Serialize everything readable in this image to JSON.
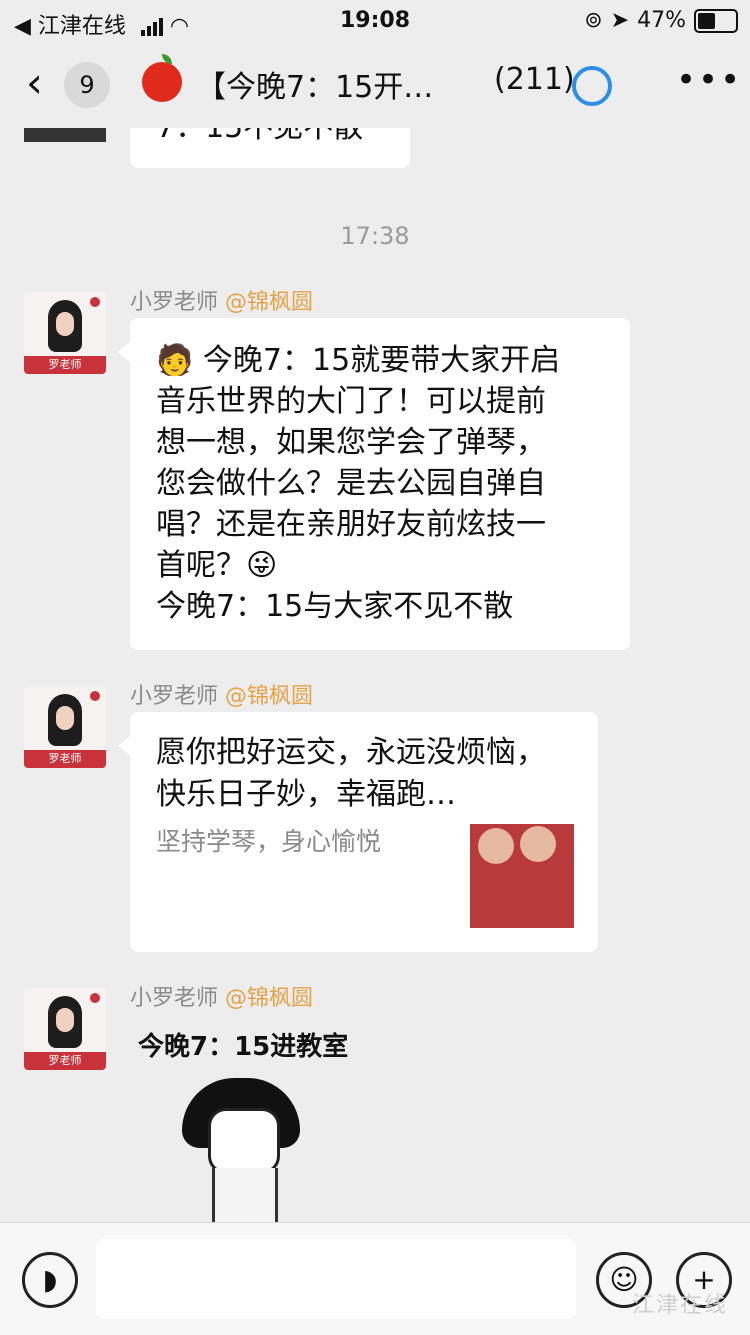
{
  "status_bar": {
    "back_app": "◀ 江津在线",
    "time": "19:08",
    "battery": "47%"
  },
  "nav": {
    "unread": "9",
    "title": "【今晚7：15开…",
    "member_count": "(211)"
  },
  "prev_bubble_tail": "7：15不见不散",
  "timestamp": "17:38",
  "messages": [
    {
      "sender": "小罗老师",
      "group_tag": "@锦枫圆",
      "avatar_label": "罗老师",
      "text": "🧑 今晚7：15就要带大家开启\n音乐世界的大门了！可以提前\n想一想，如果您学会了弹琴，\n您会做什么？是去公园自弹自\n唱？还是在亲朋好友前炫技一\n首呢？😜\n今晚7：15与大家不见不散"
    },
    {
      "sender": "小罗老师",
      "group_tag": "@锦枫圆",
      "avatar_label": "罗老师",
      "link_title": "愿你把好运交，永远没烦恼，快乐日子妙，幸福跑…",
      "link_desc": "坚持学琴，身心愉悦"
    },
    {
      "sender": "小罗老师",
      "group_tag": "@锦枫圆",
      "avatar_label": "罗老师",
      "sticker_caption": "今晚7：15进教室"
    }
  ],
  "input": {
    "placeholder": ""
  },
  "watermark": "江津在线",
  "colors": {
    "background": "#ededed",
    "group_tag": "#e7a246",
    "bubble": "#ffffff"
  }
}
